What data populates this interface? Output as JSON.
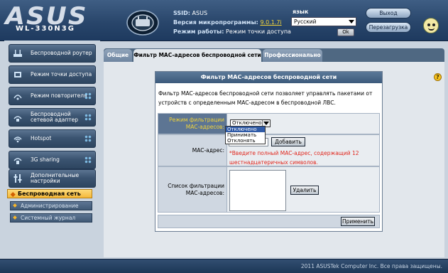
{
  "header": {
    "logo": "ASUS",
    "model": "WL-330N3G",
    "ssid_label": "SSID:",
    "ssid_value": "ASUS",
    "firmware_label": "Версия микропрограммы:",
    "firmware_value": "9.0.1.7i",
    "mode_label": "Режим работы:",
    "mode_value": "Режим точки доступа",
    "language_label": "язык",
    "language_value": "Русский",
    "language_ok": "Ok",
    "logout_label": "Выход",
    "reboot_label": "Перезагрузка"
  },
  "sidebar": {
    "items": [
      {
        "label": "Беспроводной роутер",
        "icon": "router-icon"
      },
      {
        "label": "Режим точки доступа",
        "icon": "access-point-icon"
      },
      {
        "label": "Режим повторителя",
        "icon": "repeater-icon"
      },
      {
        "label": "Беспроводной сетевой адаптер",
        "icon": "wireless-adapter-icon"
      },
      {
        "label": "Hotspot",
        "icon": "hotspot-icon"
      },
      {
        "label": "3G sharing",
        "icon": "3g-icon"
      },
      {
        "label": "Дополнительные настройки",
        "icon": "tools-icon"
      }
    ],
    "active_section": "Беспроводная сеть",
    "sub_items": [
      "Администрирование",
      "Системный журнал"
    ]
  },
  "tabs": [
    {
      "label": "Общие",
      "active": false
    },
    {
      "label": "Фильтр MAC-адресов беспроводной сети",
      "active": true
    },
    {
      "label": "Профессионально",
      "active": false
    }
  ],
  "panel": {
    "title": "Фильтр MAC-адресов беспроводной сети",
    "description": "Фильтр MAC-адресов беспроводной сети позволяет управлять пакетами от устройств с определенным MAC-адресом в беспроводной ЛВС.",
    "filter_mode_label": "Режим фильтрации MAC-адресов:",
    "filter_mode_value": "Отключено",
    "filter_mode_options": [
      "Отключено",
      "Принимать",
      "Отклонять"
    ],
    "mac_label": "MAC-адрес:",
    "add_button": "Добавить",
    "mac_hint": "*Введите полный MAC-адрес, содержащий 12 шестнадцатеричных символов.",
    "list_label": "Список фильтрации MAC-адресов:",
    "delete_button": "Удалить",
    "apply_button": "Применить"
  },
  "footer": {
    "copyright": "2011 ASUSTek Computer Inc. Все права защищены."
  },
  "colors": {
    "header_bg": "#29466b",
    "sidebar_button": "#3b5471",
    "active_section": "#f5b83a",
    "panel_title": "#3c5a7b",
    "hint_red": "#e1261c",
    "firmware_link": "#f4d53a"
  }
}
